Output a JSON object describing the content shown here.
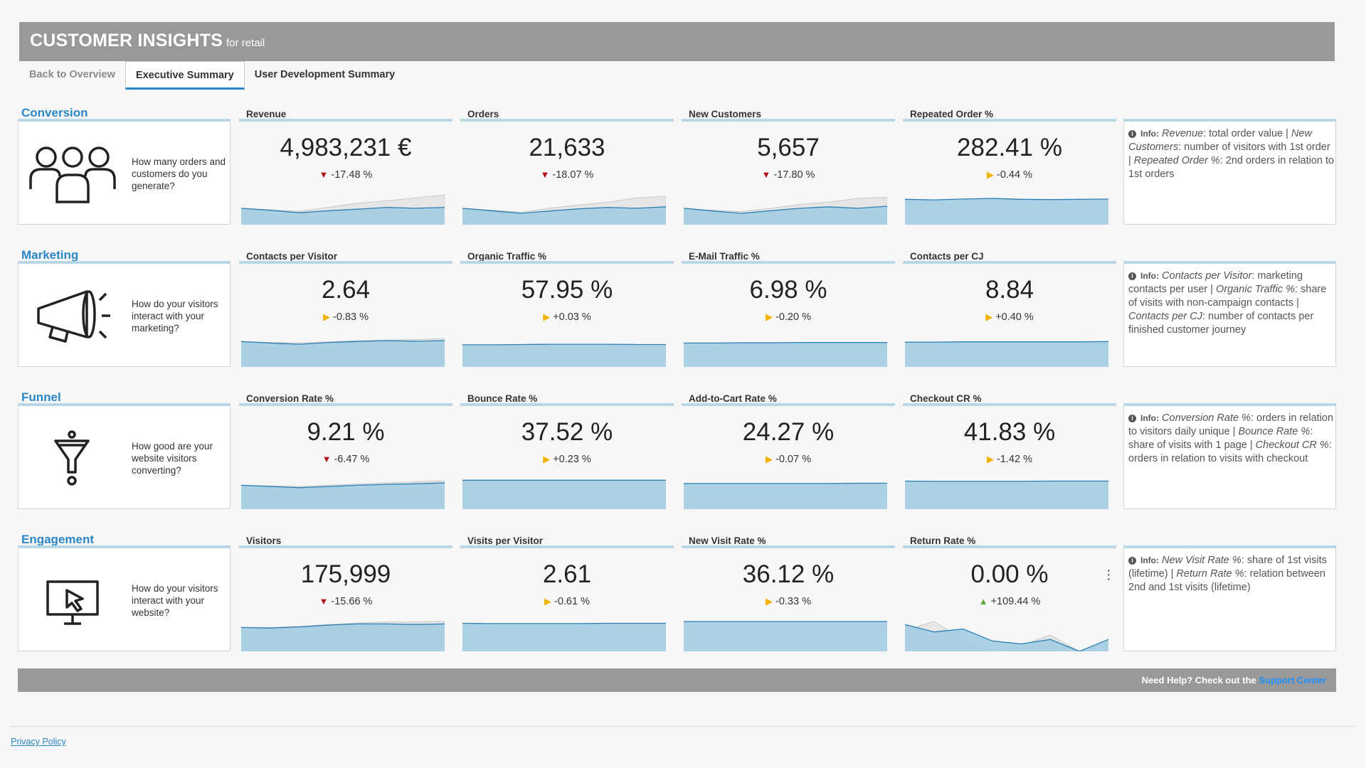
{
  "header": {
    "title": "CUSTOMER INSIGHTS",
    "subtitle": "for retail"
  },
  "tabs": [
    "Back to Overview",
    "Executive Summary",
    "User Development Summary"
  ],
  "sections": [
    {
      "label": "Conversion",
      "question": "How many orders and customers do you generate?",
      "icon": "people-icon",
      "kpis": [
        {
          "title": "Revenue",
          "value": "4,983,231 €",
          "trend": "down",
          "delta": "-17.48 %"
        },
        {
          "title": "Orders",
          "value": "21,633",
          "trend": "down",
          "delta": "-18.07 %"
        },
        {
          "title": "New Customers",
          "value": "5,657",
          "trend": "down",
          "delta": "-17.80 %"
        },
        {
          "title": "Repeated Order %",
          "value": "282.41 %",
          "trend": "flat",
          "delta": "-0.44 %"
        }
      ],
      "info_label": "Info:",
      "info": [
        {
          "t": "Revenue",
          "i": true
        },
        {
          "t": ": total order value | "
        },
        {
          "t": "New Customers",
          "i": true
        },
        {
          "t": ": number of visitors with 1st order | "
        },
        {
          "t": "Repeated Order %",
          "i": true
        },
        {
          "t": ": 2nd orders in relation to 1st orders"
        }
      ]
    },
    {
      "label": "Marketing",
      "question": "How do your visitors interact with your marketing?",
      "icon": "megaphone-icon",
      "kpis": [
        {
          "title": "Contacts per Visitor",
          "value": "2.64",
          "trend": "flat",
          "delta": "-0.83 %"
        },
        {
          "title": "Organic Traffic %",
          "value": "57.95 %",
          "trend": "flat",
          "delta": "+0.03 %"
        },
        {
          "title": "E-Mail Traffic %",
          "value": "6.98 %",
          "trend": "flat",
          "delta": "-0.20 %"
        },
        {
          "title": "Contacts per CJ",
          "value": "8.84",
          "trend": "flat",
          "delta": "+0.40 %"
        }
      ],
      "info_label": "Info:",
      "info": [
        {
          "t": "Contacts per Visitor",
          "i": true
        },
        {
          "t": ": marketing contacts per user | "
        },
        {
          "t": "Organic Traffic %",
          "i": true
        },
        {
          "t": ": share of visits with non-campaign contacts | "
        },
        {
          "t": "Contacts per CJ",
          "i": true
        },
        {
          "t": ": number of contacts per finished customer journey"
        }
      ]
    },
    {
      "label": "Funnel",
      "question": "How good are your website visitors converting?",
      "icon": "funnel-icon",
      "kpis": [
        {
          "title": "Conversion Rate %",
          "value": "9.21 %",
          "trend": "down",
          "delta": "-6.47 %"
        },
        {
          "title": "Bounce Rate %",
          "value": "37.52 %",
          "trend": "flat",
          "delta": "+0.23 %"
        },
        {
          "title": "Add-to-Cart Rate %",
          "value": "24.27 %",
          "trend": "flat",
          "delta": "-0.07 %"
        },
        {
          "title": "Checkout CR %",
          "value": "41.83 %",
          "trend": "flat",
          "delta": "-1.42 %"
        }
      ],
      "info_label": "Info:",
      "info": [
        {
          "t": "Conversion Rate %",
          "i": true
        },
        {
          "t": ": orders in relation to visitors daily unique | "
        },
        {
          "t": "Bounce Rate %",
          "i": true
        },
        {
          "t": ": share of visits with 1 page | "
        },
        {
          "t": "Checkout CR %",
          "i": true
        },
        {
          "t": ": orders in relation to visits with checkout"
        }
      ]
    },
    {
      "label": "Engagement",
      "question": "How do your visitors interact with your website?",
      "icon": "monitor-cursor-icon",
      "kpis": [
        {
          "title": "Visitors",
          "value": "175,999",
          "trend": "down",
          "delta": "-15.66 %"
        },
        {
          "title": "Visits per Visitor",
          "value": "2.61",
          "trend": "flat",
          "delta": "-0.61 %"
        },
        {
          "title": "New Visit Rate %",
          "value": "36.12 %",
          "trend": "flat",
          "delta": "-0.33 %"
        },
        {
          "title": "Return Rate %",
          "value": "0.00 %",
          "trend": "up",
          "delta": "+109.44 %"
        }
      ],
      "info_label": "Info:",
      "info": [
        {
          "t": "New Visit Rate %",
          "i": true
        },
        {
          "t": ": share of 1st visits (lifetime) | "
        },
        {
          "t": "Return Rate %",
          "i": true
        },
        {
          "t": ": relation between 2nd and 1st visits (lifetime)"
        }
      ]
    }
  ],
  "colors": {
    "accent": "#2b86c5",
    "spark_fill": "#a8cde3",
    "spark_line": "#2a7fb5",
    "compare_fill": "#e6e6e6",
    "down": "#b0141a",
    "flat": "#f0b400",
    "up": "#5caa3a"
  },
  "footer": {
    "help_text": "Need Help? Check out the",
    "help_link": "Support Center"
  },
  "privacy": "Privacy Policy"
}
